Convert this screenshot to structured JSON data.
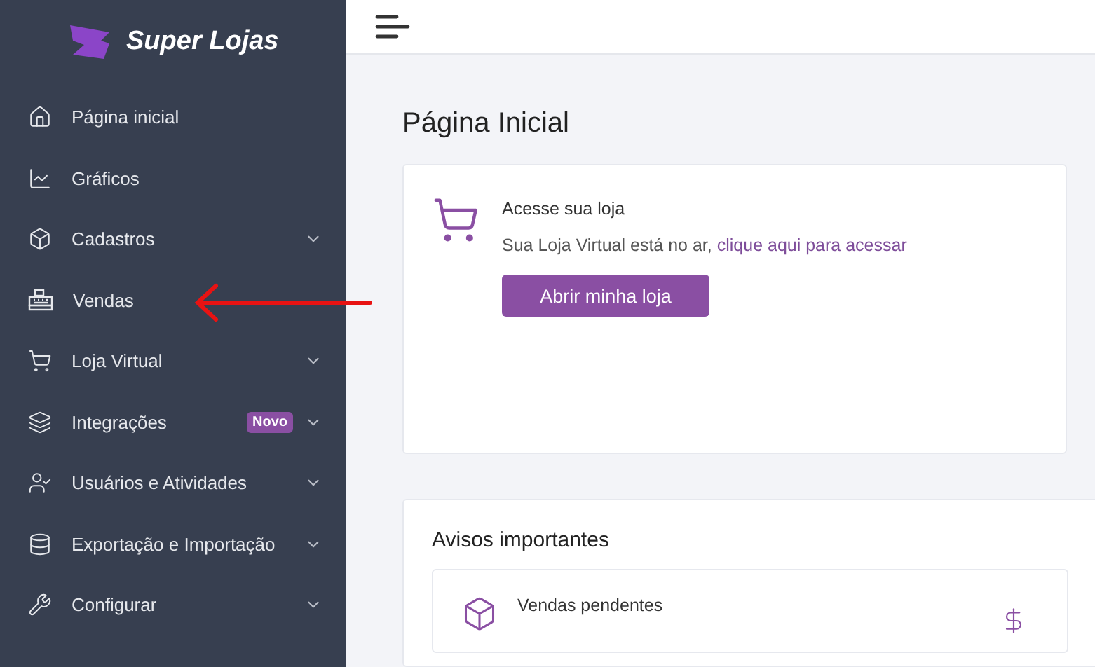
{
  "sidebar": {
    "logo": "Super Lojas",
    "items": [
      {
        "label": "Página inicial",
        "expandable": false
      },
      {
        "label": "Gráficos",
        "expandable": false
      },
      {
        "label": "Cadastros",
        "expandable": true
      },
      {
        "label": "Vendas",
        "expandable": false
      },
      {
        "label": "Loja Virtual",
        "expandable": true
      },
      {
        "label": "Integrações",
        "expandable": true,
        "badge": "Novo"
      },
      {
        "label": "Usuários e Atividades",
        "expandable": true
      },
      {
        "label": "Exportação e Importação",
        "expandable": true
      },
      {
        "label": "Configurar",
        "expandable": true
      }
    ]
  },
  "page": {
    "title": "Página Inicial",
    "store_card": {
      "heading": "Acesse sua loja",
      "text": "Sua Loja Virtual está no ar, ",
      "link": "clique aqui para acessar",
      "button": "Abrir minha loja"
    },
    "notices": {
      "title": "Avisos importantes",
      "items": [
        {
          "label": "Vendas pendentes"
        }
      ]
    }
  }
}
